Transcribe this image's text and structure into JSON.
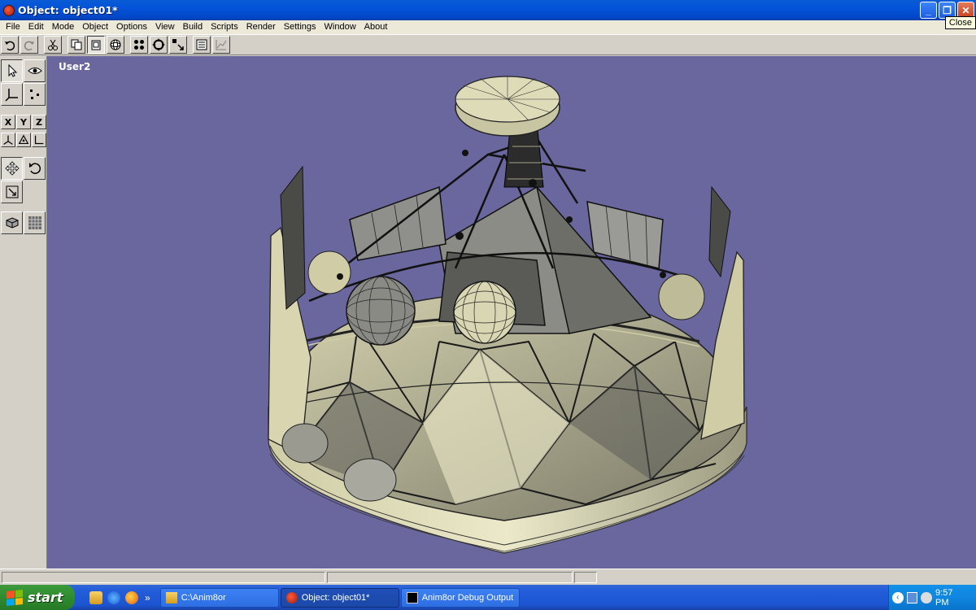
{
  "window": {
    "title": "Object: object01*",
    "tooltip": "Close"
  },
  "menu": [
    "File",
    "Edit",
    "Mode",
    "Object",
    "Options",
    "View",
    "Build",
    "Scripts",
    "Render",
    "Settings",
    "Window",
    "About"
  ],
  "toolbar": {
    "icons": [
      "undo-icon",
      "redo-icon",
      "cut-icon",
      "copy-icon",
      "paste-icon",
      "sphere-icon",
      "points-icon",
      "rotate-view-icon",
      "arrange-icon",
      "list-icon",
      "graph-icon"
    ]
  },
  "palette": {
    "axes": [
      "X",
      "Y",
      "Z"
    ]
  },
  "viewport": {
    "label": "User2",
    "background": "#6a669e"
  },
  "taskbar": {
    "start": "start",
    "tasks": [
      "C:\\Anim8or",
      "Object: object01*",
      "Anim8or Debug Output"
    ],
    "clock": "9:57 PM"
  },
  "colors": {
    "titlebar": "#0453d8",
    "model_fill": "#d9d6b3",
    "model_dark": "#4a4a4a"
  }
}
